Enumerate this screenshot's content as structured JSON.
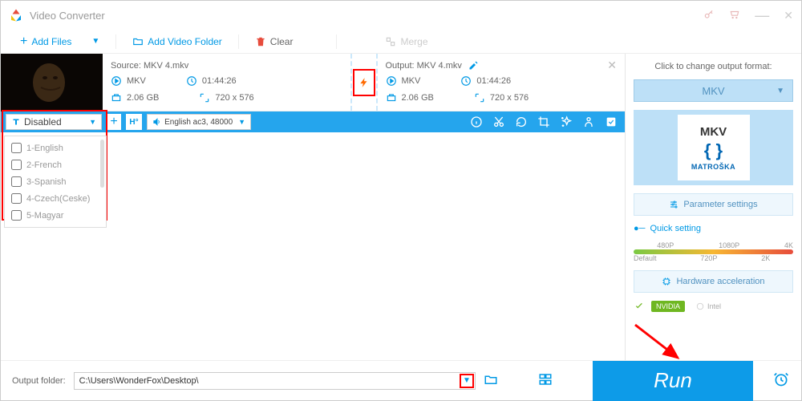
{
  "app": {
    "title": "Video Converter"
  },
  "toolbar": {
    "add_files": "Add Files",
    "add_folder": "Add Video Folder",
    "clear": "Clear",
    "merge": "Merge"
  },
  "item": {
    "source_label": "Source: MKV 4.mkv",
    "output_label": "Output: MKV 4.mkv",
    "src_fmt": "MKV",
    "src_dur": "01:44:26",
    "src_size": "2.06 GB",
    "src_res": "720 x 576",
    "out_fmt": "MKV",
    "out_dur": "01:44:26",
    "out_size": "2.06 GB",
    "out_res": "720 x 576"
  },
  "bluebar": {
    "subtitle_sel": "Disabled",
    "audio_sel": "English ac3, 48000 H"
  },
  "subtitle_options": [
    {
      "label": "1-English"
    },
    {
      "label": "2-French"
    },
    {
      "label": "3-Spanish"
    },
    {
      "label": "4-Czech(Ceske)"
    },
    {
      "label": "5-Magyar"
    }
  ],
  "right": {
    "click_to_change": "Click to change output format:",
    "format": "MKV",
    "mkv_label": "MKV",
    "mkv_brand": "MATROŠKA",
    "param_settings": "Parameter settings",
    "quick_setting": "Quick setting",
    "qs": {
      "p480": "480P",
      "p720": "720P",
      "p1080": "1080P",
      "p2k": "2K",
      "p4k": "4K",
      "default": "Default"
    },
    "hw_accel": "Hardware acceleration",
    "nvidia": "NVIDIA",
    "intel": "Intel"
  },
  "bottom": {
    "output_folder_label": "Output folder:",
    "output_folder_value": "C:\\Users\\WonderFox\\Desktop\\",
    "run": "Run"
  }
}
